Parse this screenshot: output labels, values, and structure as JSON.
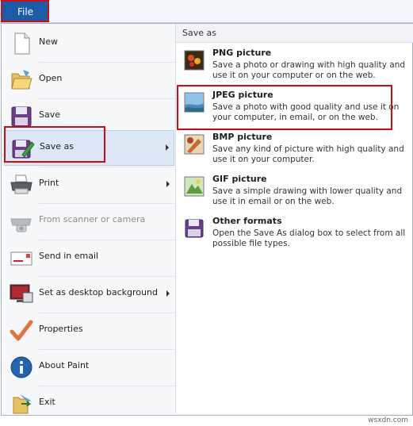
{
  "file_tab": {
    "label": "File"
  },
  "left_menu": {
    "items": [
      {
        "label": "New",
        "icon": "new-document-icon"
      },
      {
        "label": "Open",
        "icon": "folder-open-icon"
      },
      {
        "label": "Save",
        "icon": "floppy-disk-icon"
      },
      {
        "label": "Save as",
        "icon": "save-as-icon",
        "selected": true
      },
      {
        "label": "Print",
        "icon": "printer-icon"
      },
      {
        "label": "From scanner or camera",
        "icon": "scanner-icon",
        "disabled": true
      },
      {
        "label": "Send in email",
        "icon": "email-icon"
      },
      {
        "label": "Set as desktop background",
        "icon": "desktop-icon"
      },
      {
        "label": "Properties",
        "icon": "checkmark-icon"
      },
      {
        "label": "About Paint",
        "icon": "info-icon"
      },
      {
        "label": "Exit",
        "icon": "exit-icon"
      }
    ]
  },
  "save_as_panel": {
    "header": "Save as",
    "options": [
      {
        "title": "PNG picture",
        "desc": "Save a photo or drawing with high quality and use it on your computer or on the web."
      },
      {
        "title": "JPEG picture",
        "desc": "Save a photo with good quality and use it on your computer, in email, or on the web."
      },
      {
        "title": "BMP picture",
        "desc": "Save any kind of picture with high quality and use it on your computer."
      },
      {
        "title": "GIF picture",
        "desc": "Save a simple drawing with lower quality and use it in email or on the web."
      },
      {
        "title": "Other formats",
        "desc": "Open the Save As dialog box to select from all possible file types."
      }
    ]
  },
  "watermark": "wsxdn.com",
  "colors": {
    "file_tab": "#1c5ba8",
    "highlight": "#cc0d14",
    "selected": "#dde8f6"
  }
}
